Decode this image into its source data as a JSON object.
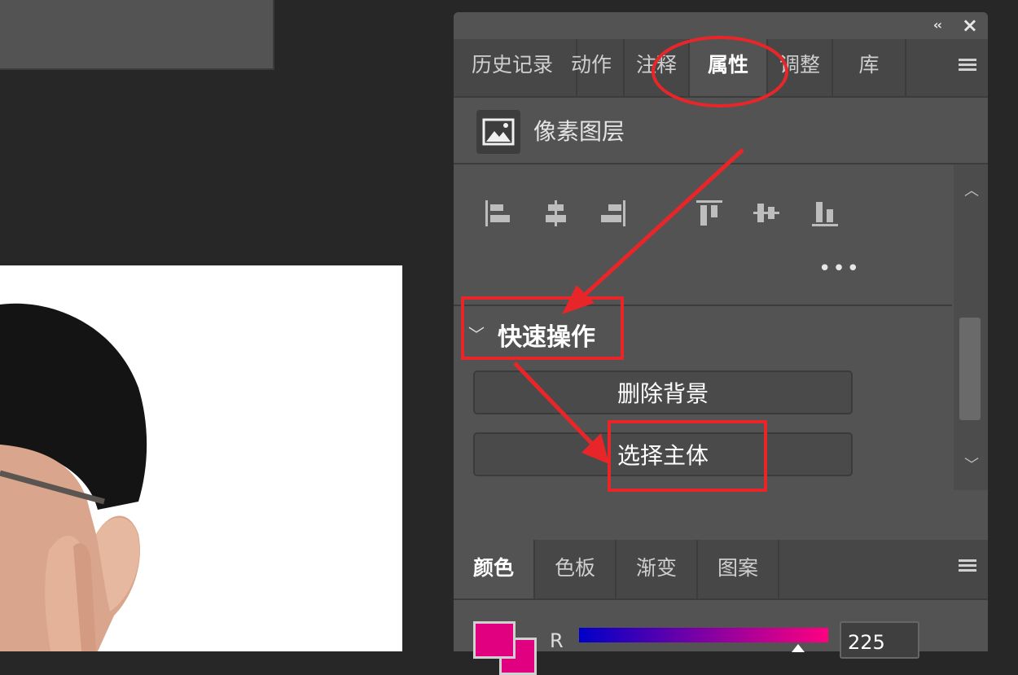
{
  "properties_panel": {
    "tabs": [
      {
        "label": "历史记录",
        "active": false
      },
      {
        "label": "动作",
        "active": false
      },
      {
        "label": "注释",
        "active": false
      },
      {
        "label": "属性",
        "active": true
      },
      {
        "label": "调整",
        "active": false
      },
      {
        "label": "库",
        "active": false
      }
    ],
    "layer_type": "像素图层",
    "more_label": "•••",
    "quick_actions": {
      "title": "快速操作",
      "remove_background": "删除背景",
      "select_subject": "选择主体"
    }
  },
  "color_panel": {
    "tabs": [
      {
        "label": "颜色",
        "active": true
      },
      {
        "label": "色板",
        "active": false
      },
      {
        "label": "渐变",
        "active": false
      },
      {
        "label": "图案",
        "active": false
      }
    ],
    "channel_label": "R",
    "channel_value": "225",
    "channel_level": 0.88,
    "foreground_color": "#e1007f"
  },
  "icons": {
    "collapse": "double-chevron-left-icon",
    "close": "close-icon",
    "menu": "hamburger-menu-icon",
    "layer": "image-layer-icon"
  },
  "annotation_color": "#e8262a"
}
